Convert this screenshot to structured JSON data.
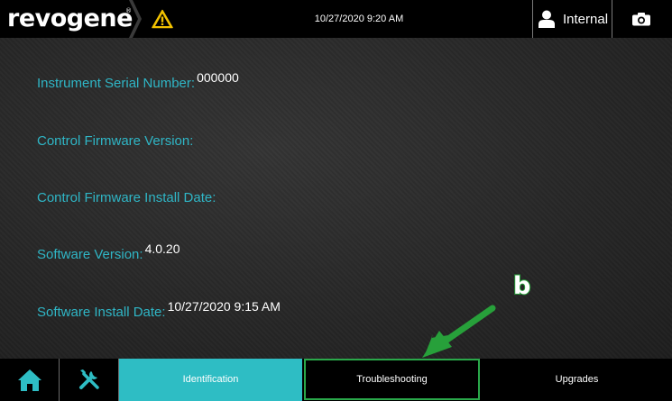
{
  "topbar": {
    "logo": "revogene",
    "logo_mark": "®",
    "warning_icon": "warning-triangle-icon",
    "datetime": "10/27/2020 9:20 AM",
    "user_label": "Internal",
    "user_icon": "user-icon",
    "camera_icon": "camera-icon"
  },
  "fields": {
    "serial": {
      "label": "Instrument Serial Number:",
      "value": "000000"
    },
    "fw_version": {
      "label": "Control Firmware Version:",
      "value": ""
    },
    "fw_install_date": {
      "label": "Control Firmware Install Date:",
      "value": ""
    },
    "sw_version": {
      "label": "Software Version:",
      "value": "4.0.20"
    },
    "sw_install_date": {
      "label": "Software Install Date:",
      "value": "10/27/2020 9:15 AM"
    }
  },
  "annotation": {
    "letter": "b",
    "color": "#27a03a"
  },
  "bottombar": {
    "home_icon": "home-icon",
    "tools_icon": "tools-icon",
    "tabs": [
      {
        "label": "Identification",
        "active": true
      },
      {
        "label": "Troubleshooting",
        "active": false
      },
      {
        "label": "Upgrades",
        "active": false
      }
    ]
  },
  "colors": {
    "accent": "#2ebdc4",
    "label_text": "#2fb6c6",
    "warning": "#f2c200",
    "highlight": "#2aa84a"
  }
}
